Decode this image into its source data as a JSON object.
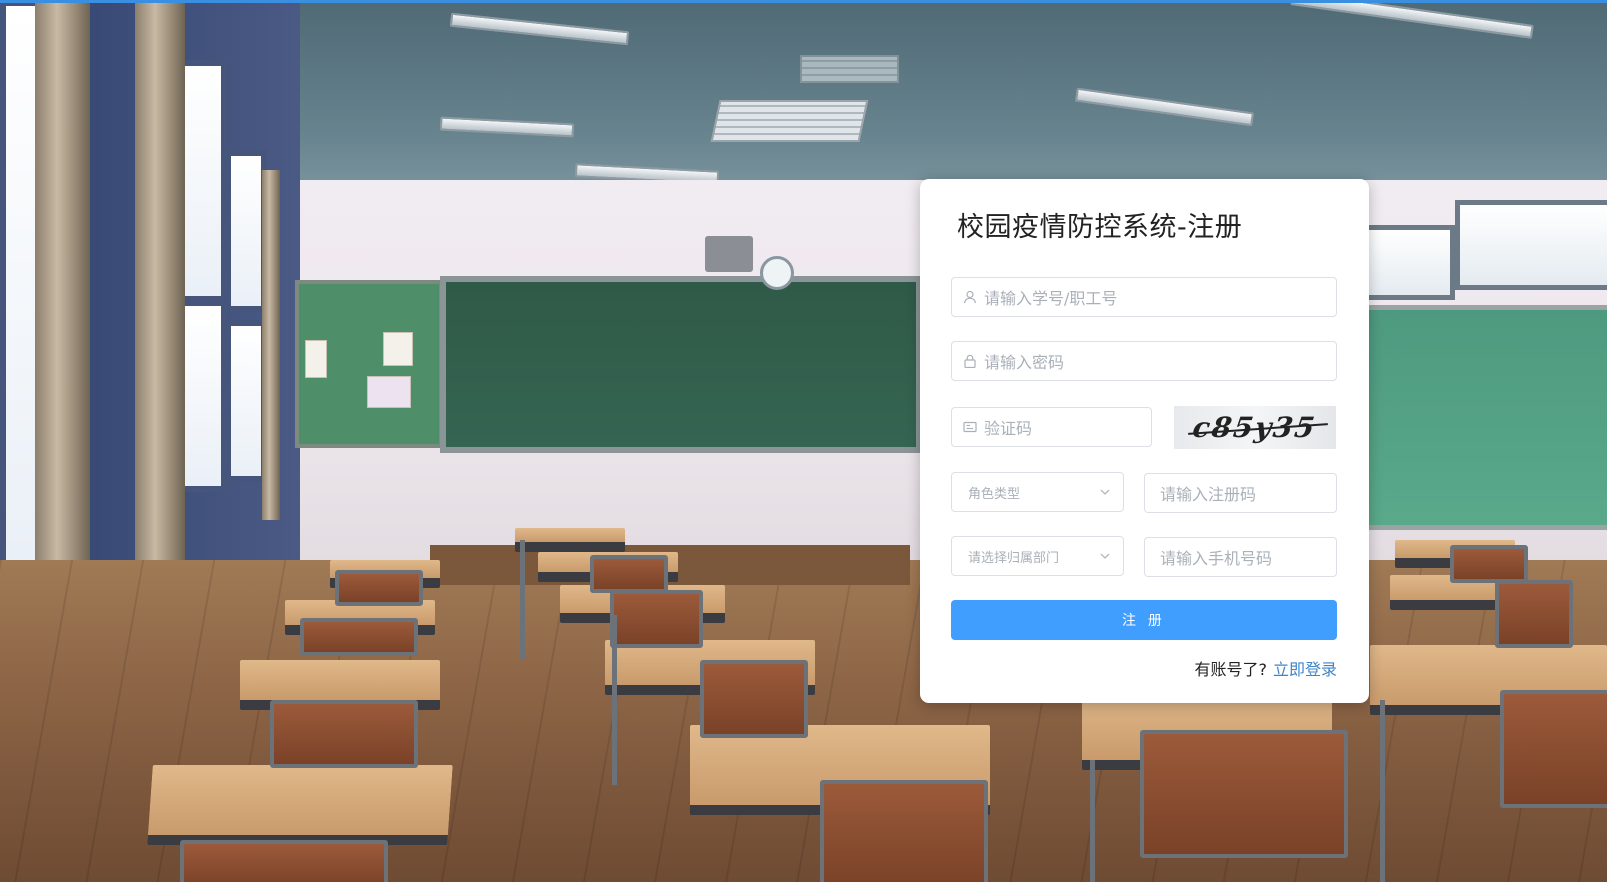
{
  "form": {
    "title": "校园疫情防控系统-注册",
    "username_placeholder": "请输入学号/职工号",
    "password_placeholder": "请输入密码",
    "captcha_placeholder": "验证码",
    "captcha_image_text": "c85y35",
    "role_select_placeholder": "角色类型",
    "register_code_placeholder": "请输入注册码",
    "department_select_placeholder": "请选择归属部门",
    "phone_placeholder": "请输入手机号码",
    "submit_label": "注 册",
    "login_prompt": "有账号了?",
    "login_link": "立即登录"
  },
  "colors": {
    "primary": "#409eff",
    "link": "#3f86c9",
    "top_bar": "#3a8fe0"
  },
  "icons": {
    "username": "user-icon",
    "password": "lock-icon",
    "captcha": "id-card-icon",
    "select": "chevron-down-icon"
  }
}
